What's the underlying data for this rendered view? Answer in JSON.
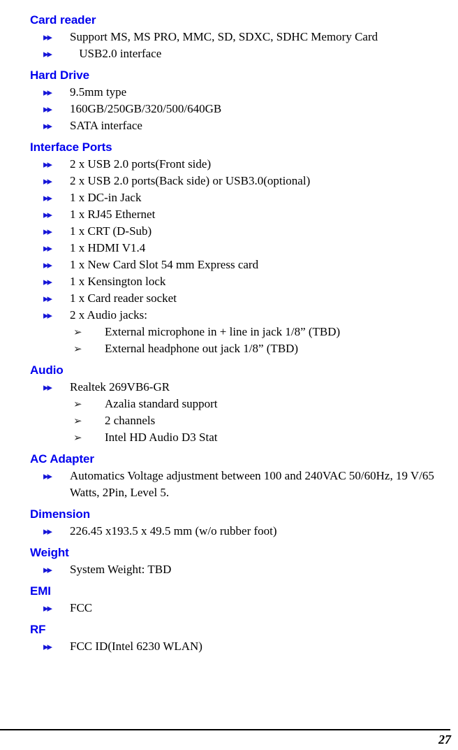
{
  "document": {
    "page_number": "27",
    "heading_color": "#0000ee",
    "bullet_color": "#1616d8",
    "subbullet_color": "#2b2b2b",
    "bullet_glyph": "▸▸",
    "subbullet_glyph": "➢"
  },
  "sections": [
    {
      "heading": "Card reader",
      "items": [
        {
          "text": "Support MS, MS PRO, MMC, SD, SDXC, SDHC Memory Card"
        },
        {
          "text": " USB2.0 interface",
          "indented": true
        }
      ]
    },
    {
      "heading": "Hard Drive",
      "items": [
        {
          "text": "9.5mm type"
        },
        {
          "text": "160GB/250GB/320/500/640GB"
        },
        {
          "text": "SATA interface"
        }
      ]
    },
    {
      "heading": "Interface Ports",
      "items": [
        {
          "text": "2 x USB 2.0 ports(Front side)"
        },
        {
          "text": "2 x USB 2.0 ports(Back side) or USB3.0(optional)"
        },
        {
          "text": "1 x DC-in Jack"
        },
        {
          "text": "1 x RJ45 Ethernet"
        },
        {
          "text": "1 x CRT (D-Sub)"
        },
        {
          "text": "1 x HDMI V1.4"
        },
        {
          "text": "1 x New Card Slot 54 mm Express card"
        },
        {
          "text": "1 x Kensington lock"
        },
        {
          "text": "1 x Card reader socket"
        },
        {
          "text": "2 x Audio jacks:",
          "subitems": [
            {
              "text": "External microphone in + line in jack 1/8” (TBD)"
            },
            {
              "text": "External headphone out jack 1/8” (TBD)"
            }
          ]
        }
      ]
    },
    {
      "heading": "Audio",
      "items": [
        {
          "text": "Realtek 269VB6-GR",
          "subitems": [
            {
              "text": "Azalia standard support"
            },
            {
              "text": "2 channels"
            },
            {
              "text": "Intel HD Audio D3 Stat"
            }
          ]
        }
      ]
    },
    {
      "heading": "AC Adapter",
      "items": [
        {
          "text": "Automatics Voltage adjustment between 100 and 240VAC 50/60Hz, 19 V/65 Watts, 2Pin, Level 5."
        }
      ]
    },
    {
      "heading": "Dimension",
      "items": [
        {
          "text": "226.45 x193.5 x 49.5 mm (w/o rubber foot)"
        }
      ]
    },
    {
      "heading": "Weight",
      "items": [
        {
          "text": "System Weight: TBD"
        }
      ]
    },
    {
      "heading": "EMI",
      "items": [
        {
          "text": "FCC"
        }
      ]
    },
    {
      "heading": "RF",
      "items": [
        {
          "text": "FCC ID(Intel 6230 WLAN)"
        }
      ]
    }
  ]
}
